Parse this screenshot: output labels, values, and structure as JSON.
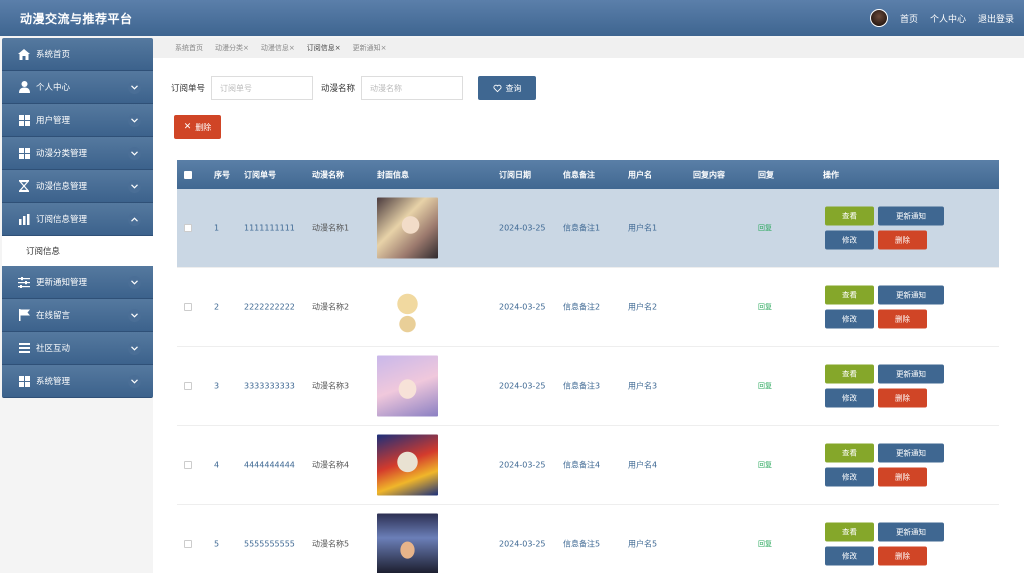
{
  "app": {
    "title": "动漫交流与推荐平台"
  },
  "header": {
    "links": [
      "首页",
      "个人中心",
      "退出登录"
    ]
  },
  "sidebar": {
    "items": [
      {
        "label": "系统首页",
        "icon": "home-icon",
        "chevron": false
      },
      {
        "label": "个人中心",
        "icon": "user-icon",
        "chevron": true
      },
      {
        "label": "用户管理",
        "icon": "grid-icon",
        "chevron": true
      },
      {
        "label": "动漫分类管理",
        "icon": "grid-icon",
        "chevron": true
      },
      {
        "label": "动漫信息管理",
        "icon": "hourglass-icon",
        "chevron": true
      },
      {
        "label": "订阅信息管理",
        "icon": "bar-chart-icon",
        "chevron": true,
        "open": true
      },
      {
        "label": "更新通知管理",
        "icon": "sliders-icon",
        "chevron": true
      },
      {
        "label": "在线留言",
        "icon": "flag-icon",
        "chevron": true
      },
      {
        "label": "社区互动",
        "icon": "list-icon",
        "chevron": true
      },
      {
        "label": "系统管理",
        "icon": "grid-icon",
        "chevron": true
      }
    ],
    "submenu": "订阅信息"
  },
  "tabs": [
    {
      "label": "系统首页",
      "closable": false
    },
    {
      "label": "动漫分类",
      "closable": true
    },
    {
      "label": "动漫信息",
      "closable": true
    },
    {
      "label": "订阅信息",
      "closable": true,
      "active": true
    },
    {
      "label": "更新通知",
      "closable": true
    }
  ],
  "search": {
    "field1_label": "订阅单号",
    "field1_placeholder": "订阅单号",
    "field2_label": "动漫名称",
    "field2_placeholder": "动漫名称",
    "query_label": "查询"
  },
  "toolbar": {
    "delete_label": "删除"
  },
  "table": {
    "columns": [
      "序号",
      "订阅单号",
      "动漫名称",
      "封面信息",
      "订阅日期",
      "信息备注",
      "用户名",
      "回复内容",
      "回复",
      "操作"
    ],
    "rows": [
      {
        "index": "1",
        "order": "1111111111",
        "name": "动漫名称1",
        "date": "2024-03-25",
        "note": "信息备注1",
        "user": "用户名1",
        "reply": "回复",
        "selected": true
      },
      {
        "index": "2",
        "order": "2222222222",
        "name": "动漫名称2",
        "date": "2024-03-25",
        "note": "信息备注2",
        "user": "用户名2",
        "reply": "回复"
      },
      {
        "index": "3",
        "order": "3333333333",
        "name": "动漫名称3",
        "date": "2024-03-25",
        "note": "信息备注3",
        "user": "用户名3",
        "reply": "回复"
      },
      {
        "index": "4",
        "order": "4444444444",
        "name": "动漫名称4",
        "date": "2024-03-25",
        "note": "信息备注4",
        "user": "用户名4",
        "reply": "回复"
      },
      {
        "index": "5",
        "order": "5555555555",
        "name": "动漫名称5",
        "date": "2024-03-25",
        "note": "信息备注5",
        "user": "用户名5",
        "reply": "回复"
      }
    ],
    "actions": {
      "view": "查看",
      "notify": "更新通知",
      "edit": "修改",
      "delete": "删除"
    }
  },
  "colors": {
    "primary": "#3f6791",
    "success": "#85a72a",
    "danger": "#d04526",
    "reply": "#2aa85c"
  }
}
